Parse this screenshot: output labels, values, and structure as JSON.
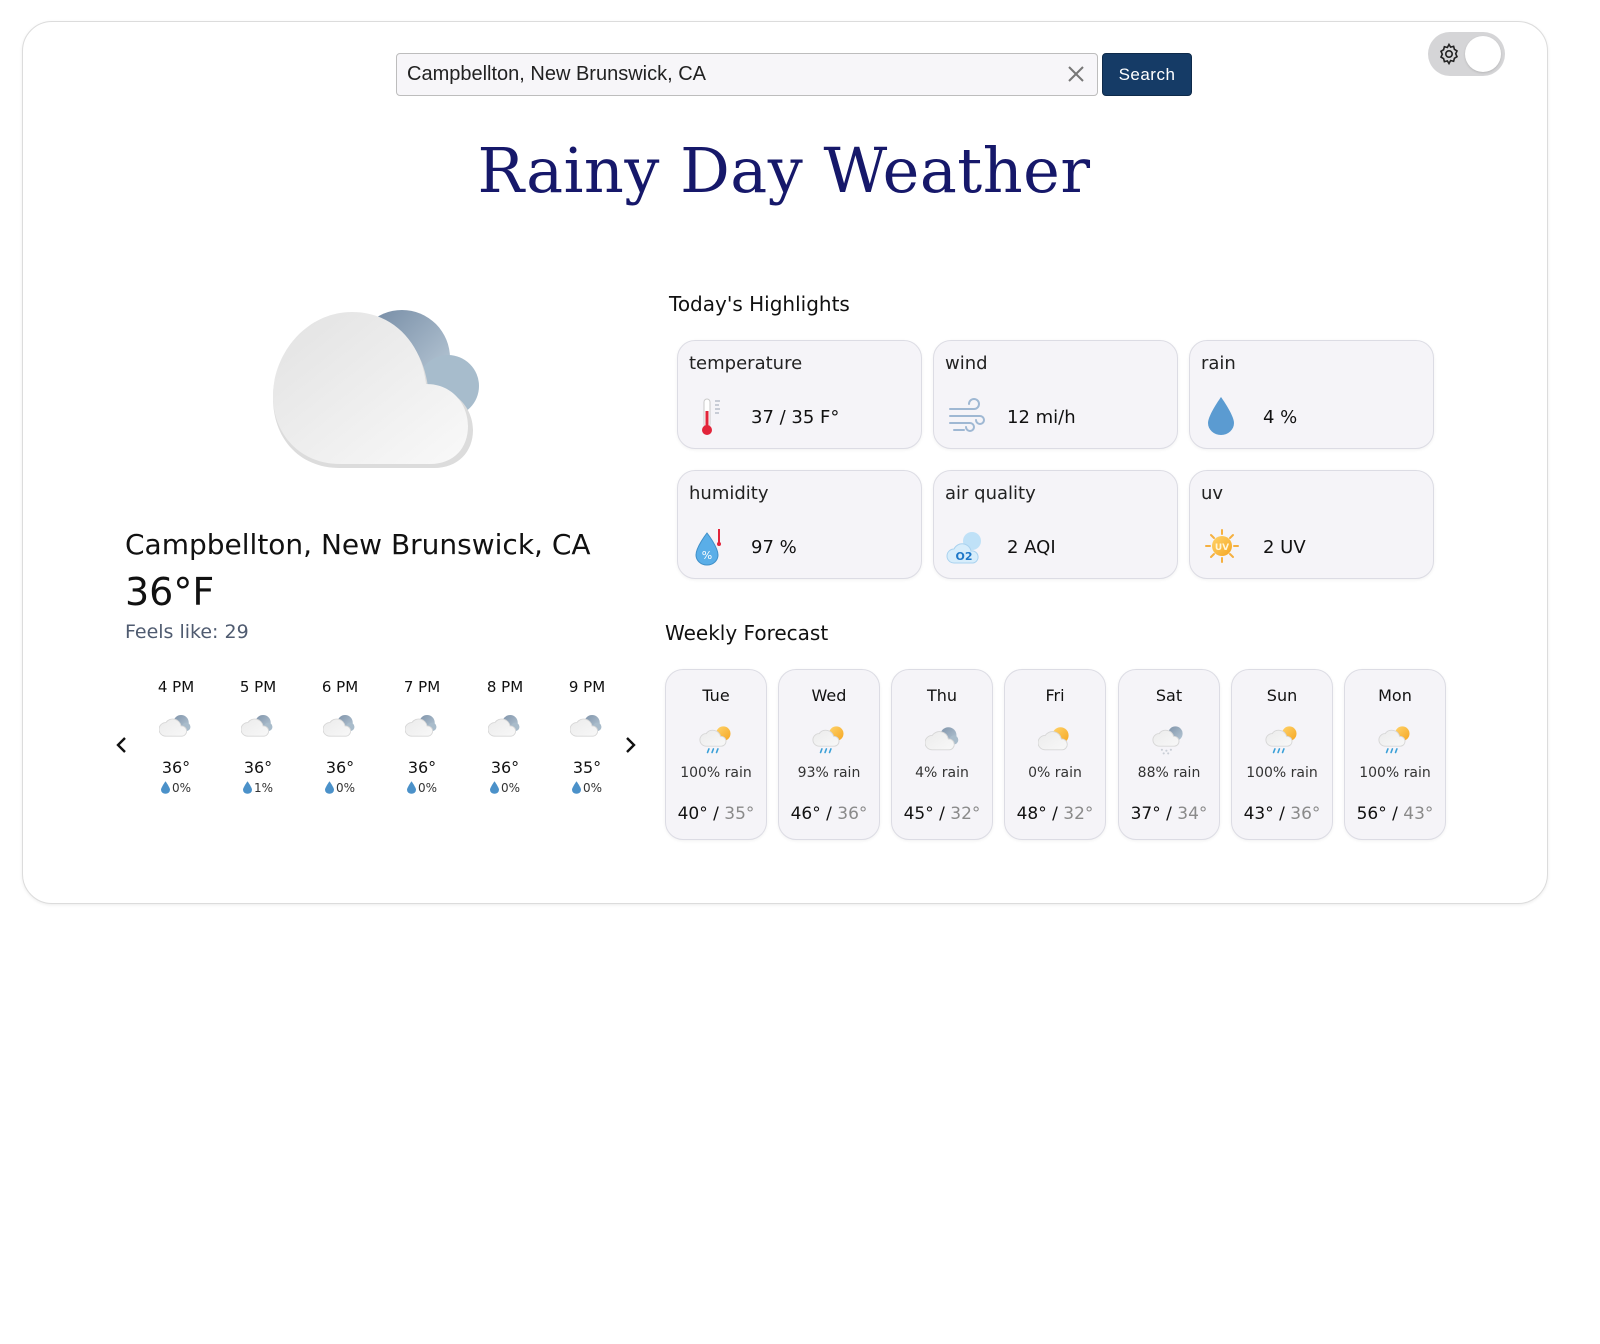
{
  "search": {
    "value": "Campbellton, New Brunswick, CA",
    "button_label": "Search"
  },
  "header": {
    "title": "Rainy Day Weather"
  },
  "current": {
    "location": "Campbellton, New Brunswick, CA",
    "temperature": "36°F",
    "feels_like": "Feels like: 29",
    "icon": "cloudy-icon"
  },
  "hourly": [
    {
      "time": "4 PM",
      "temp": "36°",
      "rain": "0%"
    },
    {
      "time": "5 PM",
      "temp": "36°",
      "rain": "1%"
    },
    {
      "time": "6 PM",
      "temp": "36°",
      "rain": "0%"
    },
    {
      "time": "7 PM",
      "temp": "36°",
      "rain": "0%"
    },
    {
      "time": "8 PM",
      "temp": "36°",
      "rain": "0%"
    },
    {
      "time": "9 PM",
      "temp": "35°",
      "rain": "0%"
    }
  ],
  "highlights": {
    "title": "Today's Highlights",
    "items": [
      {
        "label": "temperature",
        "value": "37 / 35 F°",
        "icon": "thermometer-icon"
      },
      {
        "label": "wind",
        "value": "12 mi/h",
        "icon": "wind-icon"
      },
      {
        "label": "rain",
        "value": "4 %",
        "icon": "raindrop-icon"
      },
      {
        "label": "humidity",
        "value": "97 %",
        "icon": "humidity-icon"
      },
      {
        "label": "air quality",
        "value": "2 AQI",
        "icon": "air-quality-icon"
      },
      {
        "label": "uv",
        "value": "2 UV",
        "icon": "uv-sun-icon"
      }
    ]
  },
  "weekly": {
    "title": "Weekly Forecast",
    "days": [
      {
        "day": "Tue",
        "rain": "100% rain",
        "high": "40°",
        "low": "35°",
        "icon": "sun-cloud-rain-icon"
      },
      {
        "day": "Wed",
        "rain": "93% rain",
        "high": "46°",
        "low": "36°",
        "icon": "sun-cloud-rain-icon"
      },
      {
        "day": "Thu",
        "rain": "4% rain",
        "high": "45°",
        "low": "32°",
        "icon": "cloudy-icon"
      },
      {
        "day": "Fri",
        "rain": "0% rain",
        "high": "48°",
        "low": "32°",
        "icon": "partly-sunny-icon"
      },
      {
        "day": "Sat",
        "rain": "88% rain",
        "high": "37°",
        "low": "34°",
        "icon": "cloud-snow-icon"
      },
      {
        "day": "Sun",
        "rain": "100% rain",
        "high": "43°",
        "low": "36°",
        "icon": "sun-cloud-rain-icon"
      },
      {
        "day": "Mon",
        "rain": "100% rain",
        "high": "56°",
        "low": "43°",
        "icon": "sun-cloud-rain-icon"
      }
    ]
  },
  "colors": {
    "accent": "#153b66",
    "title": "#16186a",
    "card_bg": "#f5f4f8"
  }
}
